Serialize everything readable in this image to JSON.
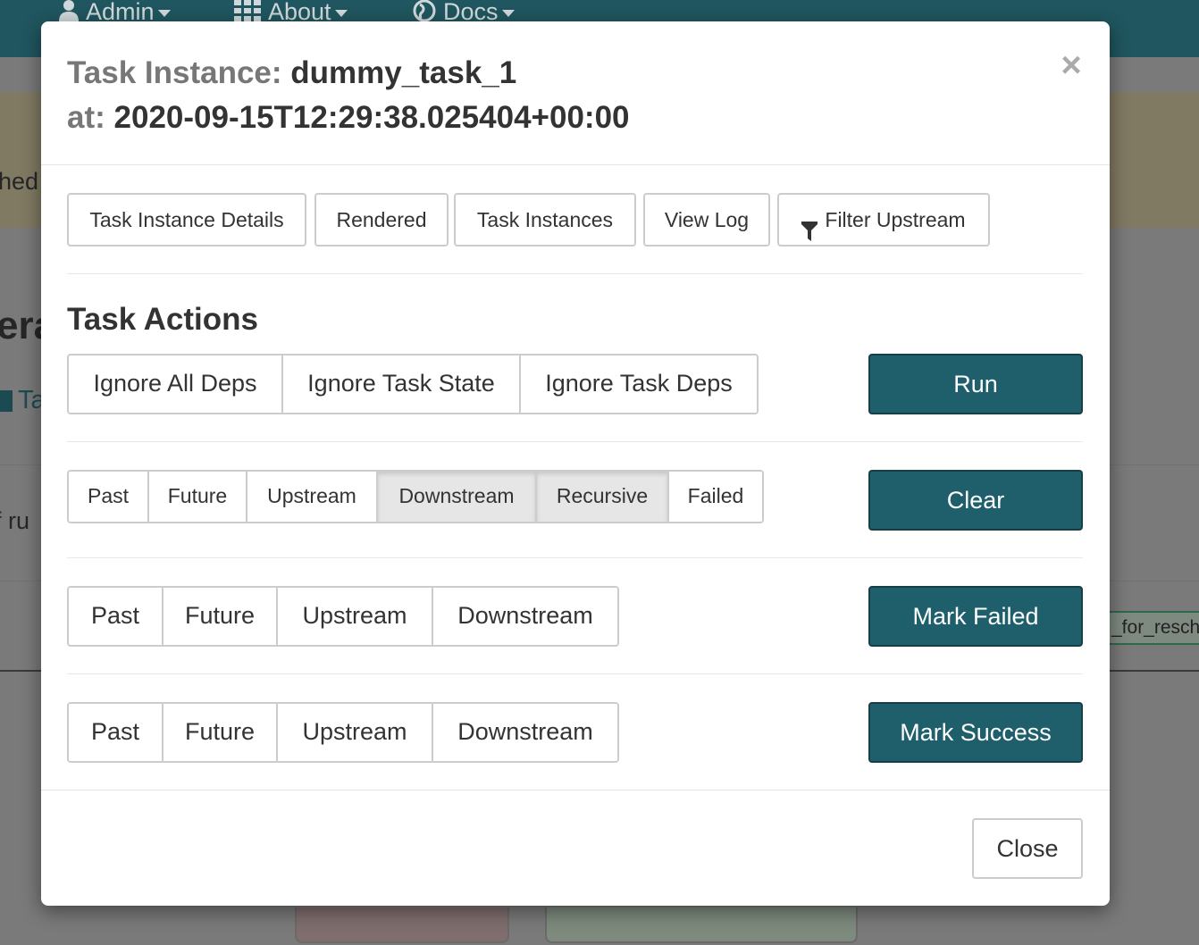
{
  "navbar": {
    "items": [
      {
        "label": "Admin",
        "icon": "user-icon"
      },
      {
        "label": "About",
        "icon": "grid-icon"
      },
      {
        "label": "Docs",
        "icon": "globe-icon"
      }
    ]
  },
  "background": {
    "fragments": [
      "hed",
      "era",
      "Ta",
      "f ru",
      "_for_resch"
    ]
  },
  "modal": {
    "title_label": "Task Instance:",
    "task_id": "dummy_task_1",
    "at_label": "at:",
    "execution_date": "2020-09-15T12:29:38.025404+00:00",
    "close_x": "×",
    "nav_buttons": [
      "Task Instance Details",
      "Rendered",
      "Task Instances",
      "View Log",
      "Filter Upstream"
    ],
    "section_title": "Task Actions",
    "run": {
      "options": [
        "Ignore All Deps",
        "Ignore Task State",
        "Ignore Task Deps"
      ],
      "button": "Run"
    },
    "clear": {
      "options": [
        "Past",
        "Future",
        "Upstream",
        "Downstream",
        "Recursive",
        "Failed"
      ],
      "active": [
        "Downstream",
        "Recursive"
      ],
      "button": "Clear"
    },
    "mark_failed": {
      "options": [
        "Past",
        "Future",
        "Upstream",
        "Downstream"
      ],
      "button": "Mark Failed"
    },
    "mark_success": {
      "options": [
        "Past",
        "Future",
        "Upstream",
        "Downstream"
      ],
      "button": "Mark Success"
    },
    "footer_close": "Close"
  },
  "colors": {
    "navbar": "#20565f",
    "action_button": "#1e5f6b",
    "active_toggle": "#e6e6e6"
  }
}
